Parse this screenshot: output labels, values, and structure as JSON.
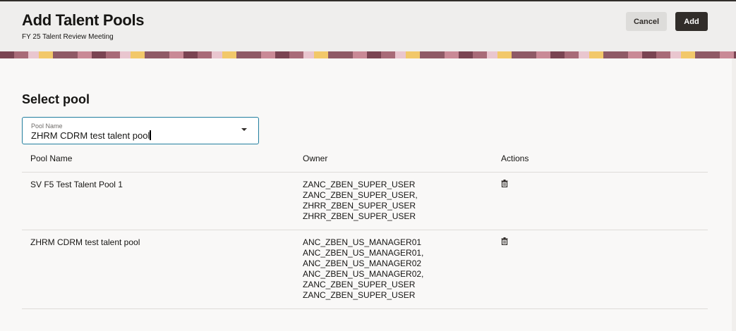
{
  "header": {
    "title": "Add Talent Pools",
    "subtitle": "FY 25 Talent Review Meeting",
    "cancel_label": "Cancel",
    "add_label": "Add"
  },
  "main": {
    "section_title": "Select pool",
    "pool_select": {
      "label": "Pool Name",
      "value": "ZHRM CDRM test talent pool"
    },
    "table": {
      "columns": [
        "Pool Name",
        "Owner",
        "Actions"
      ],
      "rows": [
        {
          "name": "SV F5 Test Talent Pool 1",
          "owners": [
            "ZANC_ZBEN_SUPER_USER",
            "ZANC_ZBEN_SUPER_USER,",
            "ZHRR_ZBEN_SUPER_USER",
            "ZHRR_ZBEN_SUPER_USER"
          ]
        },
        {
          "name": "ZHRM CDRM test talent pool",
          "owners": [
            "ANC_ZBEN_US_MANAGER01",
            "ANC_ZBEN_US_MANAGER01,",
            "ANC_ZBEN_US_MANAGER02",
            "ANC_ZBEN_US_MANAGER02,",
            "ZANC_ZBEN_SUPER_USER",
            "ZANC_ZBEN_SUPER_USER"
          ]
        }
      ]
    }
  }
}
